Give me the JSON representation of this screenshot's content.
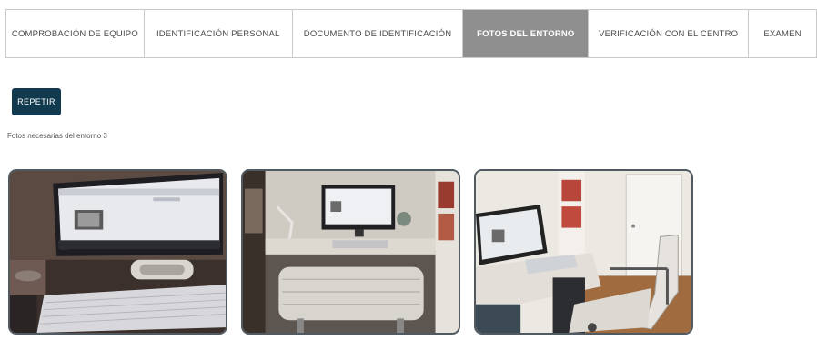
{
  "steps": [
    {
      "label": "COMPROBACIÓN DE EQUIPO",
      "active": false
    },
    {
      "label": "IDENTIFICACIÓN PERSONAL",
      "active": false
    },
    {
      "label": "DOCUMENTO DE IDENTIFICACIÓN",
      "active": false
    },
    {
      "label": "FOTOS DEL ENTORNO",
      "active": true
    },
    {
      "label": "VERIFICACIÓN CON EL CENTRO",
      "active": false
    },
    {
      "label": "EXAMEN",
      "active": false
    }
  ],
  "retry_button": {
    "label": "REPETIR"
  },
  "hint_text": "Fotos necesarias del entorno 3",
  "photos": [
    {
      "subject": "monitor-and-keyboard-closeup"
    },
    {
      "subject": "desk-with-monitor-and-chair"
    },
    {
      "subject": "monitor-desk-and-office-chair"
    }
  ],
  "colors": {
    "active_step_bg": "#8f8f8f",
    "button_bg": "#123a4e",
    "border": "#c9c9c9"
  }
}
